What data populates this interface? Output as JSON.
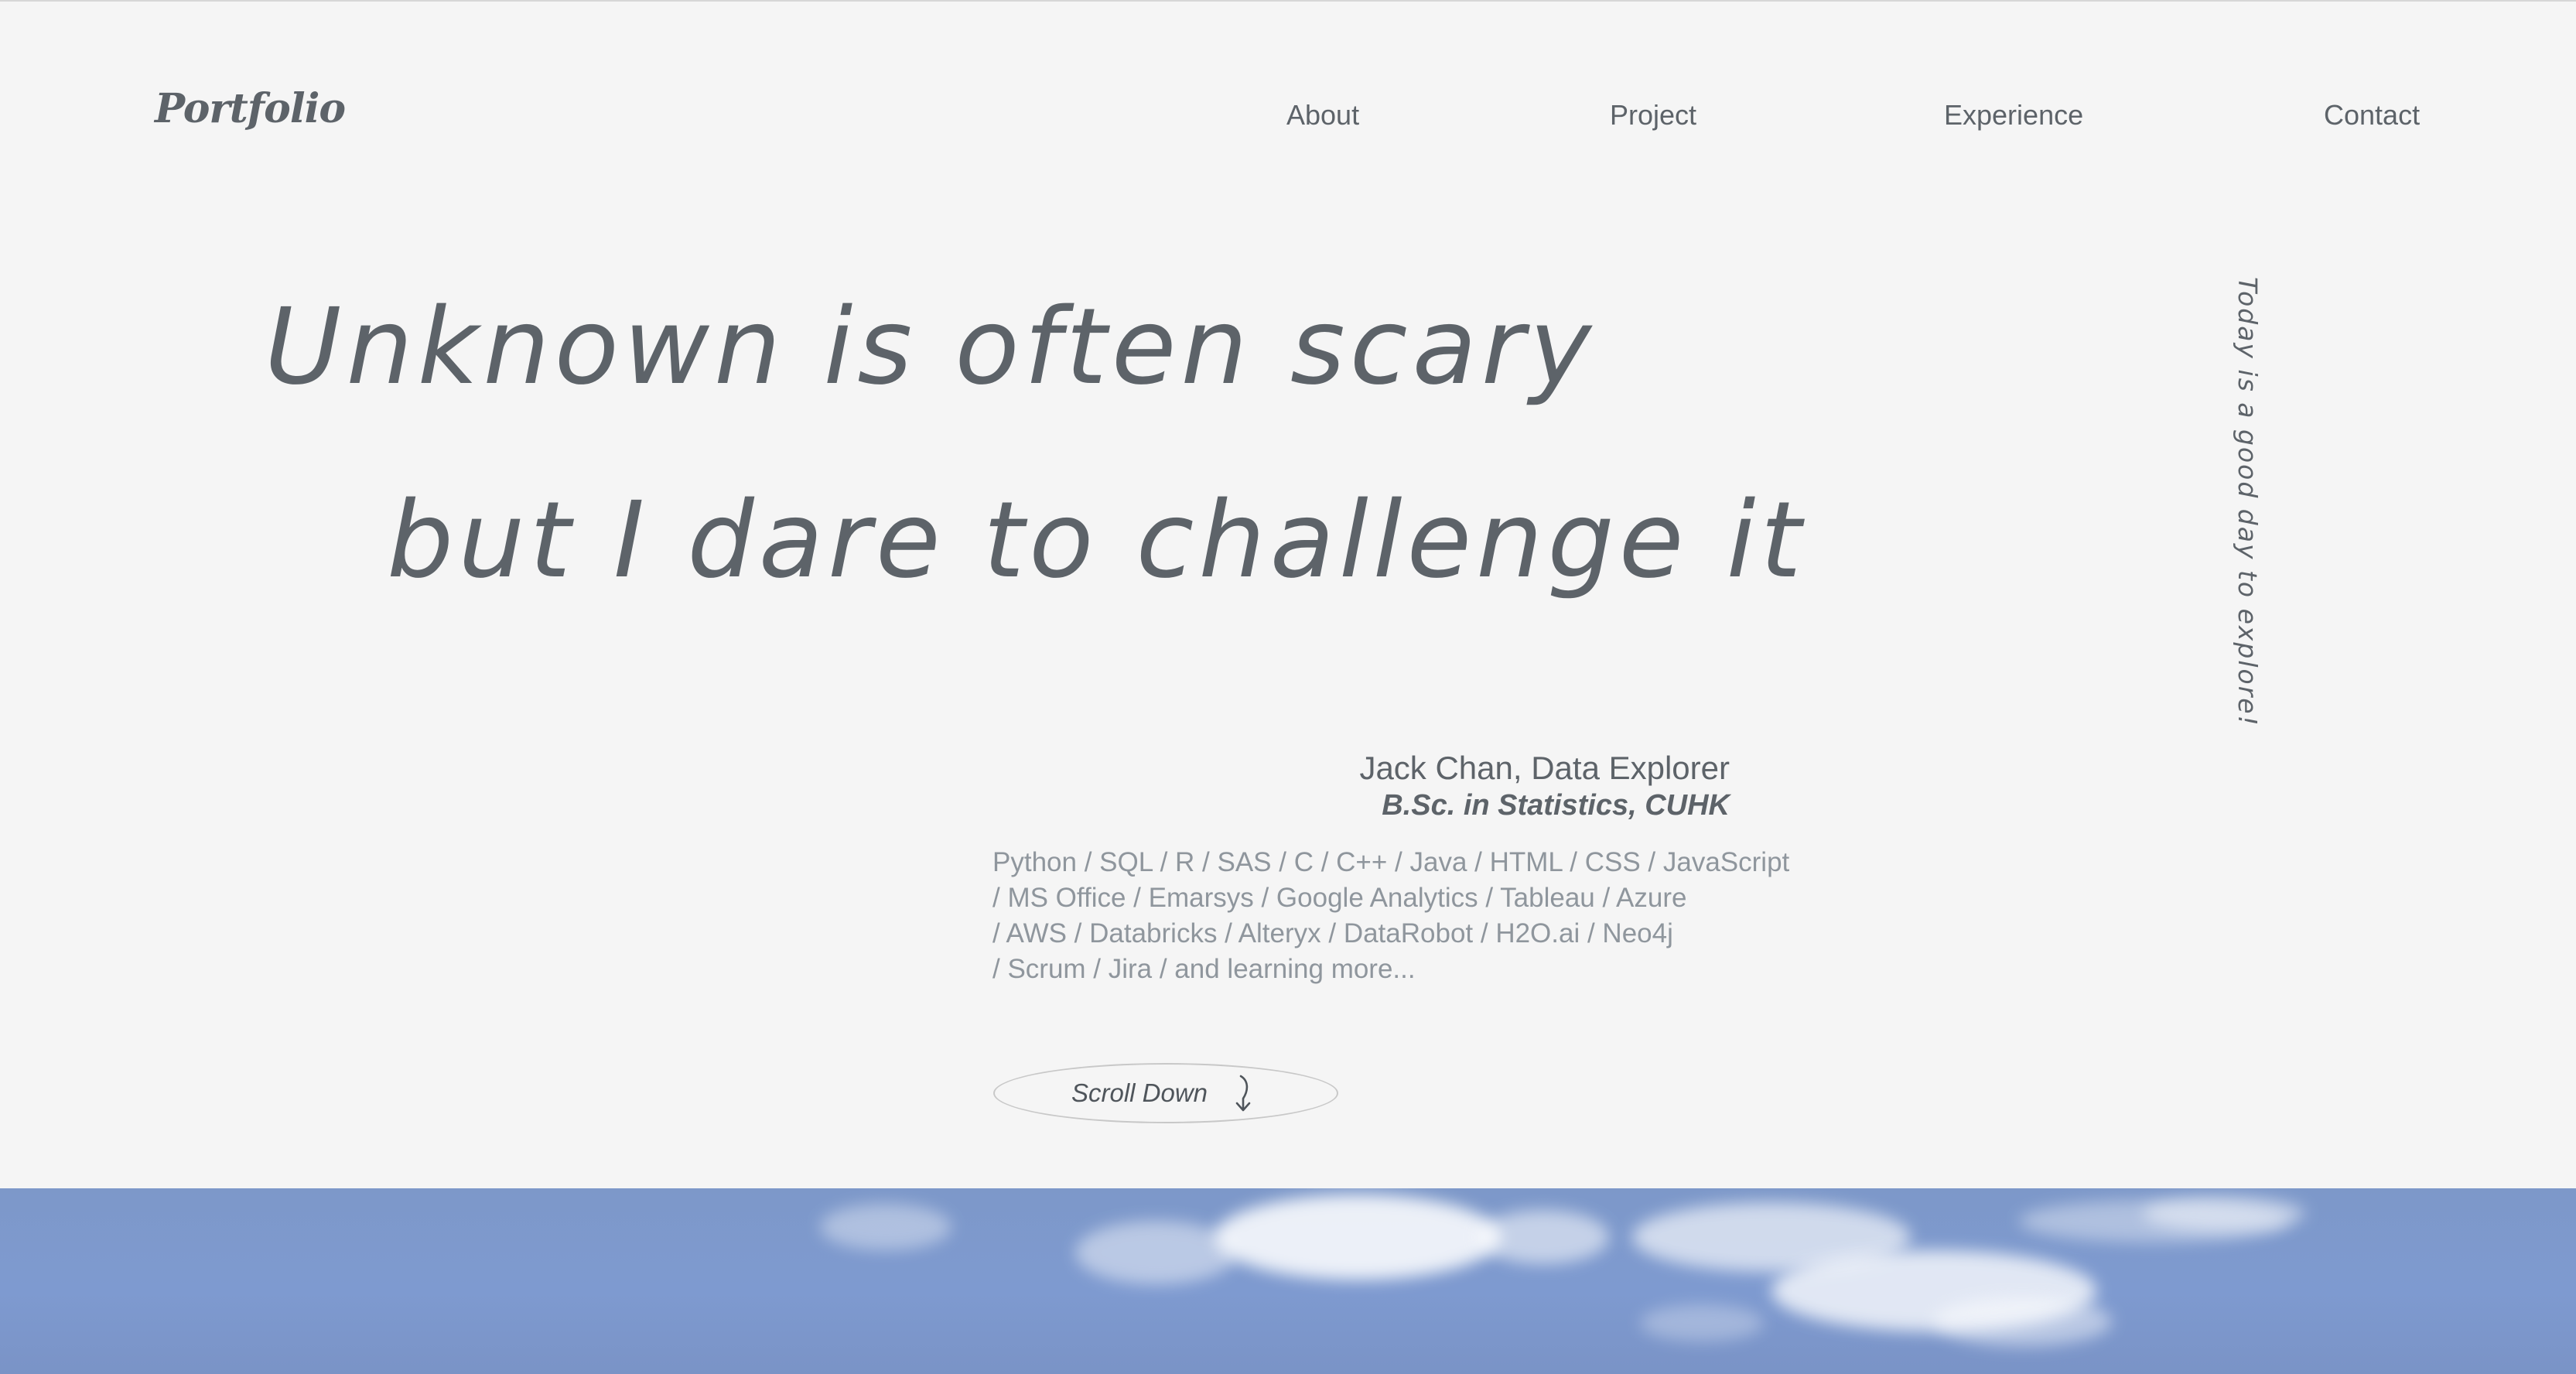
{
  "header": {
    "logo": "Portfolio",
    "nav": [
      "About",
      "Project",
      "Experience",
      "Contact"
    ]
  },
  "hero": {
    "line1": "Unknown is often scary",
    "line2": "but I dare to challenge it",
    "vertical_tagline": "Today is a good day to explore!"
  },
  "profile": {
    "name": "Jack Chan, Data Explorer",
    "degree": "B.Sc. in Statistics, CUHK",
    "skills": [
      "Python / SQL / R / SAS / C / C++ / Java / HTML / CSS / JavaScript",
      " / MS Office / Emarsys / Google Analytics / Tableau / Azure",
      " / AWS / Databricks / Alteryx / DataRobot / H2O.ai / Neo4j",
      " / Scrum / Jira / and learning more..."
    ]
  },
  "scroll_button": {
    "label": "Scroll Down",
    "icon": "down-arrow-icon"
  },
  "colors": {
    "background": "#f5f5f5",
    "text": "#5d6369",
    "muted_text": "#8f969d",
    "sky": "#7e9ad0"
  }
}
